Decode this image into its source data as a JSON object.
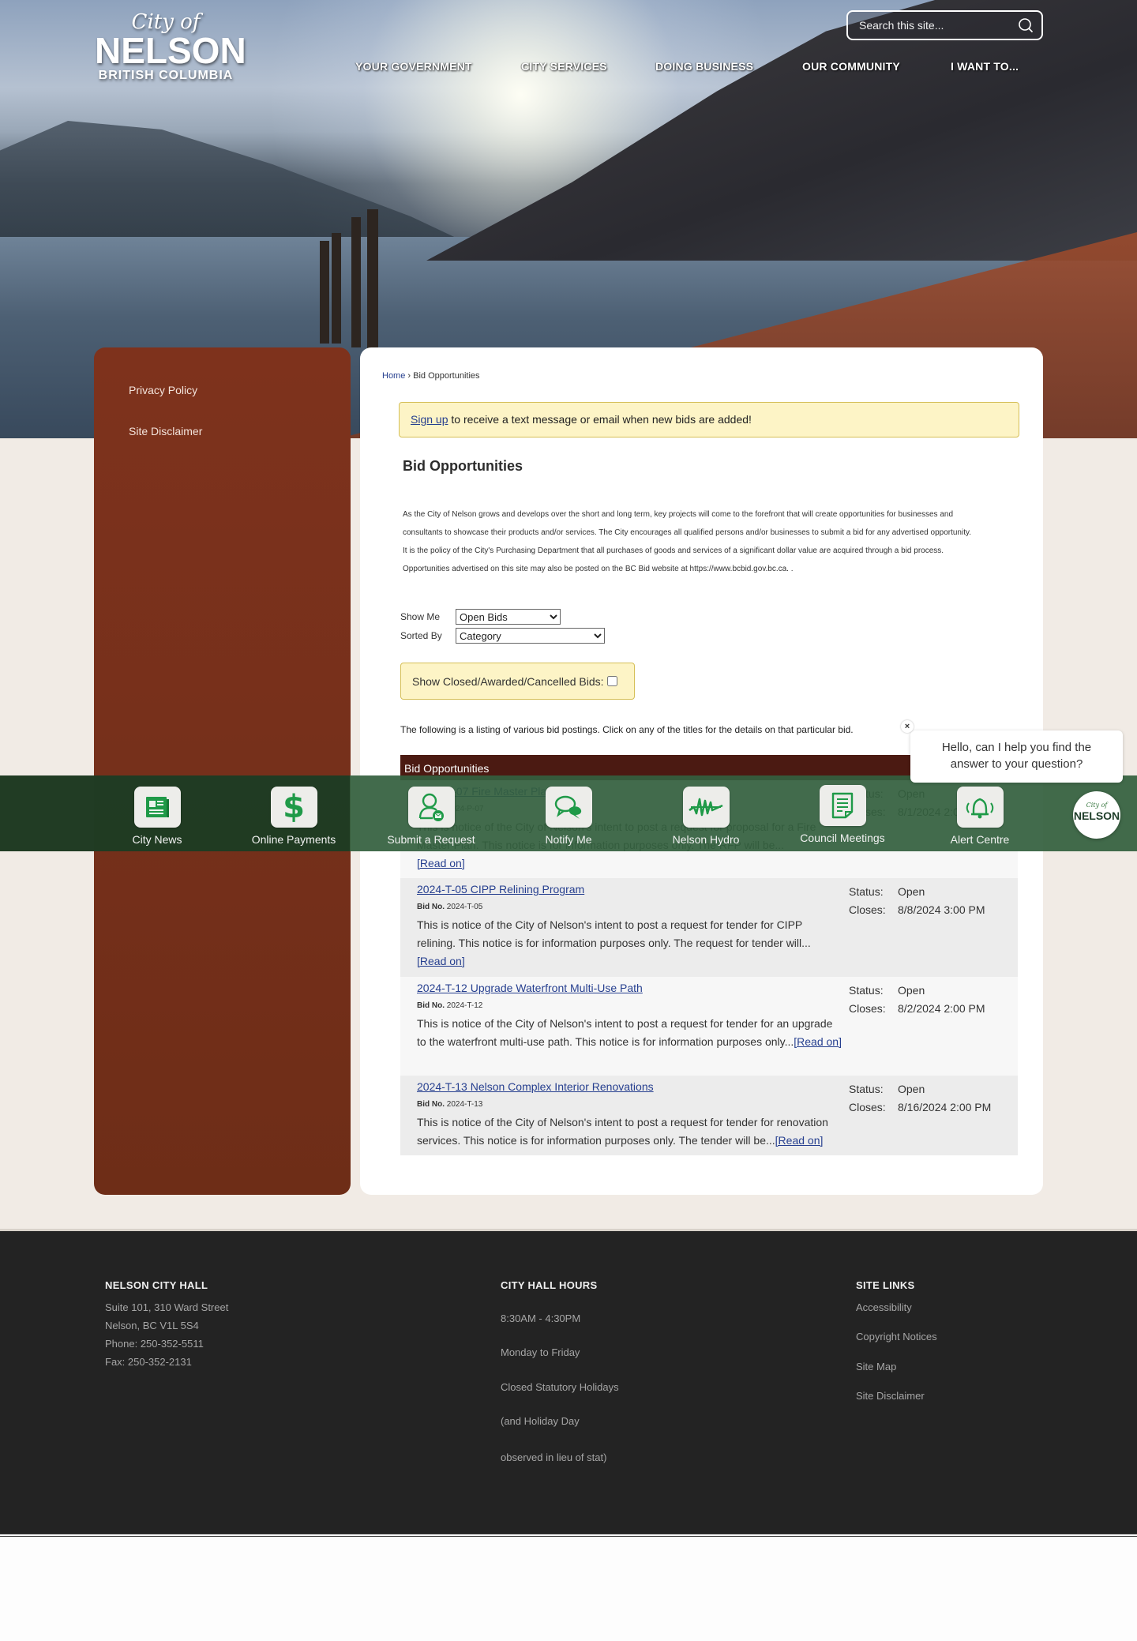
{
  "logo": {
    "line1": "City of",
    "line2": "NELSON",
    "line3": "BRITISH COLUMBIA"
  },
  "search": {
    "placeholder": "Search this site...",
    "value": ""
  },
  "nav": {
    "items": [
      {
        "label": "YOUR GOVERNMENT"
      },
      {
        "label": "CITY SERVICES"
      },
      {
        "label": "DOING BUSINESS"
      },
      {
        "label": "OUR COMMUNITY"
      },
      {
        "label": "I WANT TO..."
      }
    ]
  },
  "sidebar": {
    "items": [
      {
        "label": "Privacy Policy"
      },
      {
        "label": "Site Disclaimer"
      }
    ]
  },
  "breadcrumb": {
    "home": "Home",
    "separator": "›",
    "current": "Bid Opportunities"
  },
  "signup": {
    "link": "Sign up",
    "text": " to receive a text message or email when new bids are added!"
  },
  "page_title": "Bid Opportunities",
  "intro": [
    "As the City of Nelson grows and develops over the short and long term, key projects will come to the forefront that will create opportunities for businesses and",
    "consultants to showcase their products and/or services. The City encourages all qualified persons and/or businesses to submit a bid for any advertised opportunity.",
    "It is the policy of the City's Purchasing Department that all purchases of goods and services of a significant dollar value are acquired through a bid process.",
    "Opportunities advertised on this site may also be posted on the BC Bid website at https://www.bcbid.gov.bc.ca. ."
  ],
  "filters": {
    "show_me_label": "Show Me",
    "show_me_value": "Open Bids",
    "sorted_by_label": "Sorted By",
    "sorted_by_value": "Category",
    "closed_label": "Show Closed/Awarded/Cancelled Bids:",
    "closed_checked": false
  },
  "listing_note": "The following is a listing of various bid postings. Click on any of the titles for the details on that particular bid.",
  "table": {
    "header": "Bid Opportunities",
    "status_key": "Status:",
    "closes_key": "Closes:",
    "bid_no_key": "Bid No.",
    "read_on": "[Read on]",
    "rows": [
      {
        "title": "2024-P-07 Fire Master Plan",
        "bid_no": "2024-P-07",
        "desc": "This is notice of the City of Nelson's intent to post a request for proposal for a Fire Master Plan. This notice is for information purposes only. The RFP will be...",
        "status": "Open",
        "closes": "8/1/2024 2:00 PM"
      },
      {
        "title": "2024-T-05 CIPP Relining Program",
        "bid_no": "2024-T-05",
        "desc": "This is notice of the City of Nelson's intent to post a request for tender for CIPP relining. This notice is for information purposes only. The request for tender will...",
        "status": "Open",
        "closes": "8/8/2024 3:00 PM"
      },
      {
        "title": "2024-T-12 Upgrade Waterfront Multi-Use Path",
        "bid_no": "2024-T-12",
        "desc": "This is notice of the City of Nelson's intent to post a request for tender for an upgrade to the waterfront multi-use path. This notice is for information purposes only...",
        "status": "Open",
        "closes": "8/2/2024 2:00 PM"
      },
      {
        "title": "2024-T-13 Nelson Complex Interior Renovations",
        "bid_no": "2024-T-13",
        "desc": "This is notice of the City of Nelson's intent to post a request for tender for renovation services. This notice is for information purposes only. The tender will be...",
        "status": "Open",
        "closes": "8/16/2024 2:00 PM"
      }
    ]
  },
  "quicklinks": [
    {
      "label": "City News",
      "icon": "newspaper-icon"
    },
    {
      "label": "Online Payments",
      "icon": "dollar-icon"
    },
    {
      "label": "Submit a Request",
      "icon": "user-mail-icon"
    },
    {
      "label": "Notify Me",
      "icon": "chat-bubbles-icon"
    },
    {
      "label": "Nelson Hydro",
      "icon": "hydro-logo-icon"
    },
    {
      "label": "Council Meetings",
      "icon": "document-icon"
    },
    {
      "label": "Alert Centre",
      "icon": "bell-icon"
    }
  ],
  "chat": {
    "close": "×",
    "message": "Hello, can I help you find the answer to your question?",
    "launcher_line1": "City of",
    "launcher_line2": "NELSON"
  },
  "footer": {
    "city_hall": {
      "heading": "NELSON CITY HALL",
      "lines": [
        "Suite 101, 310 Ward Street",
        "Nelson, BC V1L 5S4",
        "Phone: 250-352-5511",
        "Fax: 250-352-2131"
      ]
    },
    "hours": {
      "heading": "CITY HALL HOURS",
      "lines": [
        "8:30AM - 4:30PM",
        "Monday to Friday",
        "Closed Statutory Holidays",
        "(and Holiday Day",
        "observed in lieu of stat)"
      ]
    },
    "site_links": {
      "heading": "SITE LINKS",
      "links": [
        "Accessibility",
        "Copyright Notices",
        "Site Map",
        "Site Disclaimer"
      ]
    }
  },
  "colors": {
    "sidebar_bg": "#7e321c",
    "table_header_bg": "#4b1a12",
    "quickbar_bg": "#34603e",
    "link": "#263f8f",
    "notice_bg": "#fdf4c6",
    "footer_bg": "#232323"
  }
}
